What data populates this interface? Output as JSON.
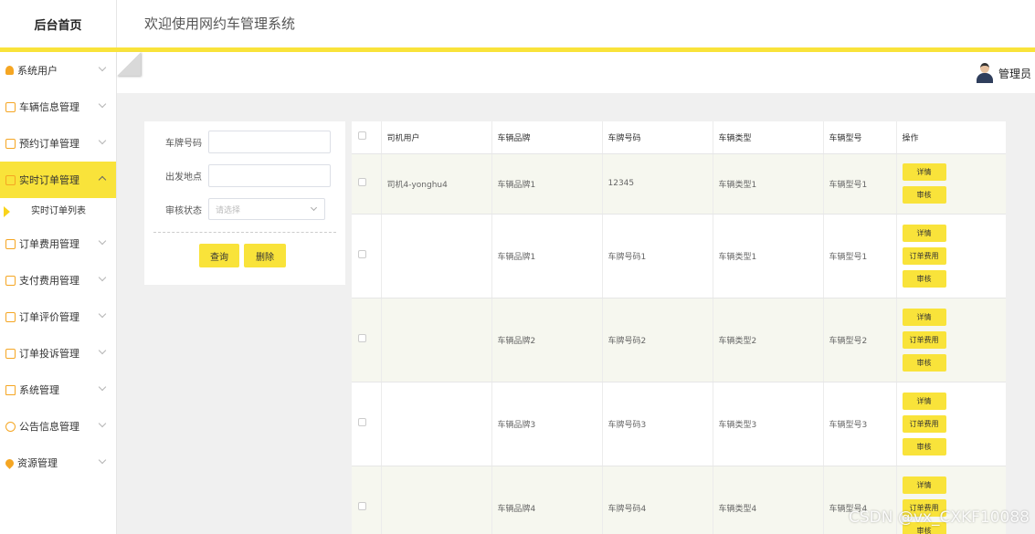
{
  "header": {
    "brand": "后台首页",
    "system_title": "欢迎使用网约车管理系统",
    "admin_name": "管理员"
  },
  "sidebar": {
    "items": [
      {
        "label": "系统用户",
        "icon": "user-icon"
      },
      {
        "label": "车辆信息管理",
        "icon": "document-icon"
      },
      {
        "label": "预约订单管理",
        "icon": "document-icon"
      },
      {
        "label": "实时订单管理",
        "icon": "document-icon",
        "active": true
      },
      {
        "label": "订单费用管理",
        "icon": "document-icon"
      },
      {
        "label": "支付费用管理",
        "icon": "document-icon"
      },
      {
        "label": "订单评价管理",
        "icon": "document-icon"
      },
      {
        "label": "订单投诉管理",
        "icon": "document-icon"
      },
      {
        "label": "系统管理",
        "icon": "image-icon"
      },
      {
        "label": "公告信息管理",
        "icon": "info-icon"
      },
      {
        "label": "资源管理",
        "icon": "pin-icon"
      }
    ],
    "sub_item": "实时订单列表"
  },
  "search": {
    "plate_label": "车牌号码",
    "plate_value": "",
    "origin_label": "出发地点",
    "origin_value": "",
    "status_label": "审核状态",
    "status_placeholder": "请选择",
    "query_button": "查询",
    "delete_button": "删除"
  },
  "table": {
    "headers": [
      "司机用户",
      "车辆品牌",
      "车牌号码",
      "车辆类型",
      "车辆型号",
      "操作"
    ],
    "rows": [
      {
        "driver": "司机4-yonghu4",
        "brand": "车辆品牌1",
        "plate": "12345",
        "type": "车辆类型1",
        "model": "车辆型号1",
        "ops": [
          "详情",
          "审核"
        ]
      },
      {
        "driver": "",
        "brand": "车辆品牌1",
        "plate": "车牌号码1",
        "type": "车辆类型1",
        "model": "车辆型号1",
        "ops": [
          "详情",
          "订单费用",
          "审核"
        ]
      },
      {
        "driver": "",
        "brand": "车辆品牌2",
        "plate": "车牌号码2",
        "type": "车辆类型2",
        "model": "车辆型号2",
        "ops": [
          "详情",
          "订单费用",
          "审核"
        ]
      },
      {
        "driver": "",
        "brand": "车辆品牌3",
        "plate": "车牌号码3",
        "type": "车辆类型3",
        "model": "车辆型号3",
        "ops": [
          "详情",
          "订单费用",
          "审核"
        ]
      },
      {
        "driver": "",
        "brand": "车辆品牌4",
        "plate": "车牌号码4",
        "type": "车辆类型4",
        "model": "车辆型号4",
        "ops": [
          "详情",
          "订单费用",
          "审核"
        ]
      }
    ]
  },
  "watermark": "CSDN @vx_CXKF10088",
  "colors": {
    "accent": "#f9e33a",
    "icon": "#f5a623"
  }
}
